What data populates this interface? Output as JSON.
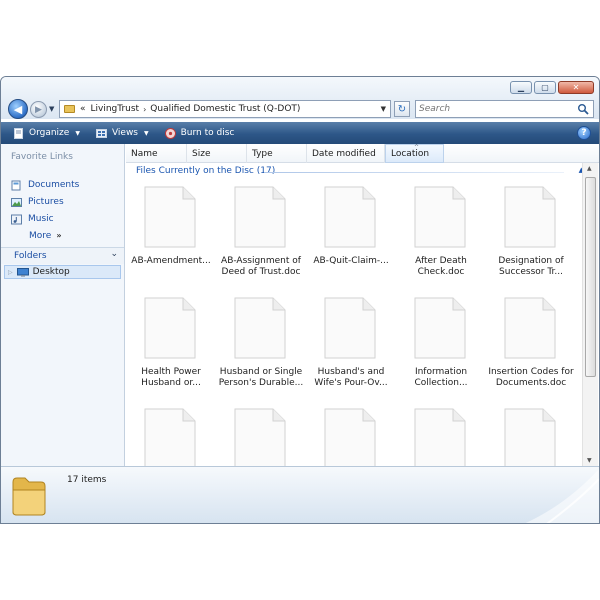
{
  "window": {
    "address": {
      "prefix": "«",
      "crumbs": [
        "LivingTrust",
        "Qualified Domestic Trust (Q-DOT)"
      ],
      "separator": "›"
    },
    "search": {
      "placeholder": "Search"
    }
  },
  "toolbar": {
    "organize_label": "Organize",
    "views_label": "Views",
    "burn_label": "Burn to disc"
  },
  "nav": {
    "favorites_heading": "Favorite Links",
    "favorites": [
      {
        "label": "Documents",
        "icon": "documents-icon"
      },
      {
        "label": "Pictures",
        "icon": "pictures-icon"
      },
      {
        "label": "Music",
        "icon": "music-icon"
      }
    ],
    "more_label": "More",
    "folders_label": "Folders",
    "tree": [
      {
        "label": "Desktop",
        "icon": "desktop-icon"
      }
    ]
  },
  "columns": [
    "Name",
    "Size",
    "Type",
    "Date modified",
    "Location"
  ],
  "group": {
    "label": "Files Currently on the Disc (17)"
  },
  "files": [
    {
      "line1": "AB-Amendment...",
      "line2": ""
    },
    {
      "line1": "AB-Assignment of",
      "line2": "Deed of Trust.doc"
    },
    {
      "line1": "AB-Quit-Claim-...",
      "line2": ""
    },
    {
      "line1": "After Death",
      "line2": "Check.doc"
    },
    {
      "line1": "Designation of",
      "line2": "Successor Tr..."
    },
    {
      "line1": "Health Power",
      "line2": "Husband or..."
    },
    {
      "line1": "Husband or Single",
      "line2": "Person's Durable..."
    },
    {
      "line1": "Husband's and",
      "line2": "Wife's Pour-Ov..."
    },
    {
      "line1": "Information",
      "line2": "Collection..."
    },
    {
      "line1": "Insertion Codes for",
      "line2": "Documents.doc"
    },
    {
      "line1": "",
      "line2": ""
    },
    {
      "line1": "",
      "line2": ""
    },
    {
      "line1": "",
      "line2": ""
    },
    {
      "line1": "",
      "line2": ""
    },
    {
      "line1": "",
      "line2": ""
    }
  ],
  "details": {
    "count_label": "17 items"
  },
  "colors": {
    "toolbar": "#2d5788",
    "link": "#1b4ea3",
    "group_header": "#1b56b0",
    "selection": "#dbe9f9"
  }
}
